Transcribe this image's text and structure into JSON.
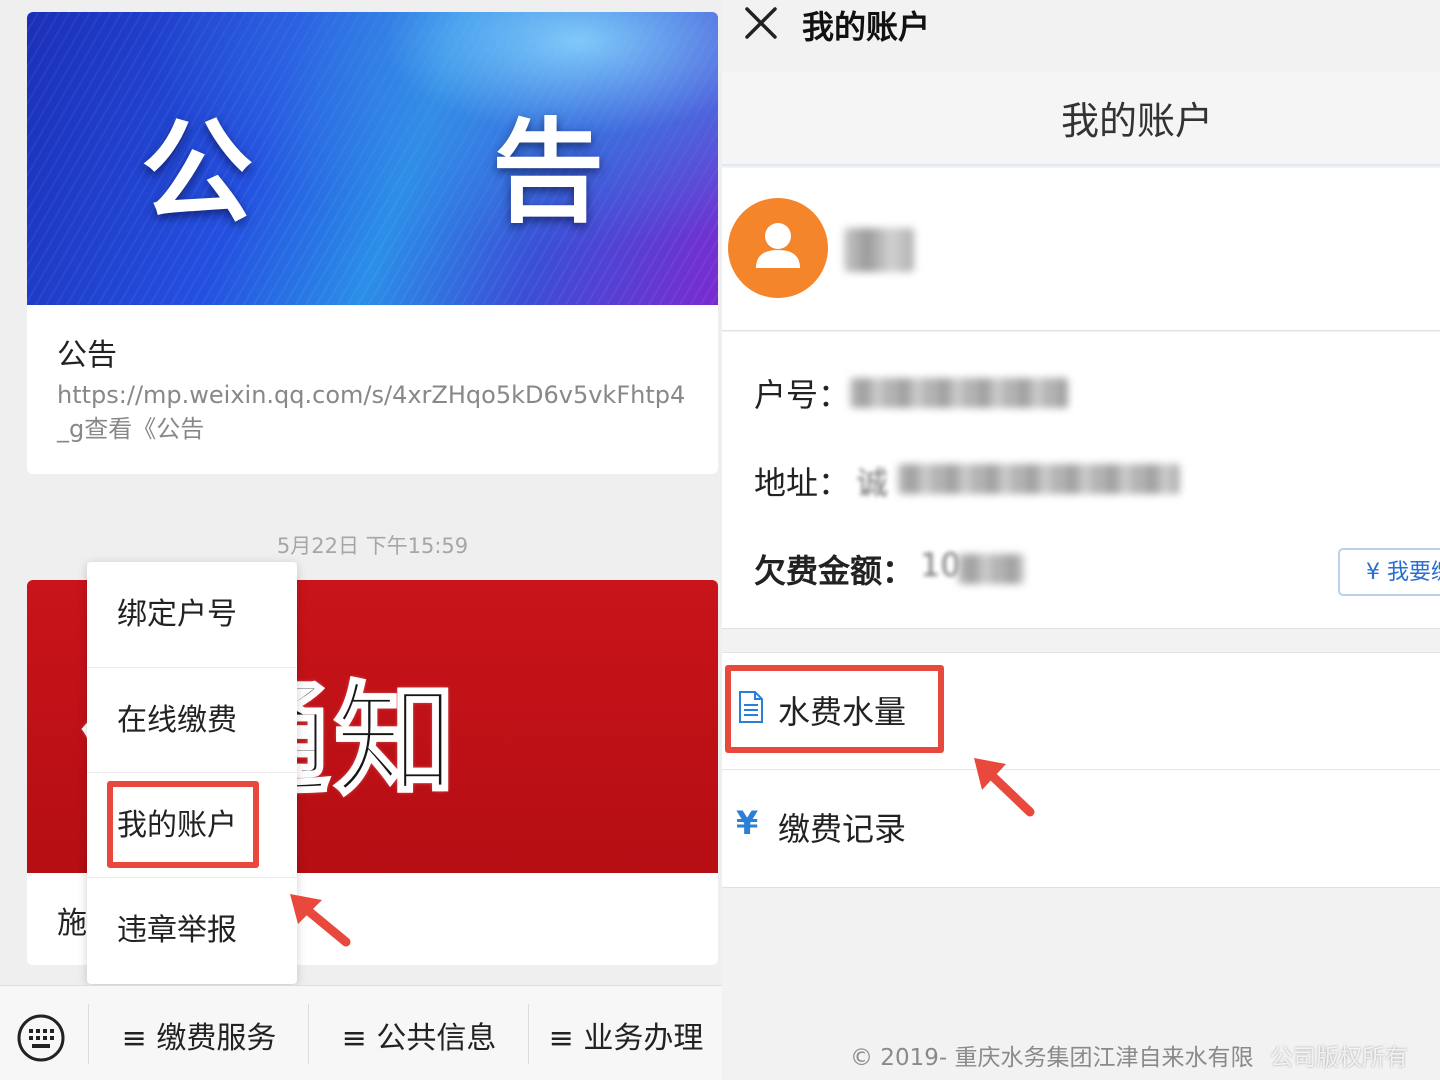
{
  "left": {
    "card1": {
      "banner_text": "公 告",
      "title": "公告",
      "description": "https://mp.weixin.qq.com/s/4xrZHqo5kD6v5vkFhtp4_g查看《公告"
    },
    "timestamp": "5月22日 下午15:59",
    "card2": {
      "banner_text": "停通知",
      "title": "施"
    },
    "popup_menu": {
      "items": [
        "绑定户号",
        "在线缴费",
        "我的账户",
        "违章举报"
      ],
      "highlighted": "我的账户"
    },
    "bottom_menu": {
      "keyboard_icon": "keyboard-icon",
      "buttons": [
        "≡ 缴费服务",
        "≡ 公共信息",
        "≡ 业务办理"
      ]
    }
  },
  "right": {
    "window_title": "我的账户",
    "header_title": "我的账户",
    "account": {
      "account_no_label": "户号：",
      "address_label": "地址：",
      "address_prefix": "诚",
      "arrears_label": "欠费金额：",
      "arrears_prefix": "10",
      "pay_button": "¥ 我要缴"
    },
    "links": [
      {
        "icon": "document-icon",
        "label": "水费水量"
      },
      {
        "icon": "yen-icon",
        "label": "缴费记录"
      }
    ],
    "footer": "© 2019- 重庆水务集团江津自来水有限",
    "watermark": "公司版权所有"
  },
  "colors": {
    "highlight_red": "#e8493c",
    "avatar_orange": "#f5852b",
    "link_blue": "#2a7fd6"
  }
}
